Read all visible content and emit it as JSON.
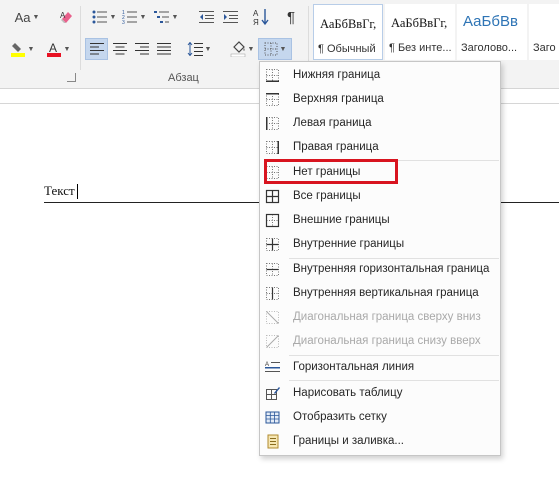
{
  "ribbon": {
    "font_size_label": "Aa",
    "paragraph_group_label": "Абзац",
    "sort_label": "А↓Я",
    "pilcrow": "¶",
    "styles": [
      {
        "sample": "АаБбВвГг,",
        "name": "¶ Обычный"
      },
      {
        "sample": "АаБбВвГг,",
        "name": "¶ Без инте..."
      },
      {
        "sample": "АаБбВв",
        "name": "Заголово..."
      },
      {
        "sample": "",
        "name": "Заго"
      }
    ],
    "colors": {
      "highlight": "#ffff00",
      "font": "#e81123"
    }
  },
  "document": {
    "text": "Текст"
  },
  "menu": {
    "items": [
      {
        "label": "Нижняя граница",
        "icon": "bottom-border-icon",
        "enabled": true
      },
      {
        "label": "Верхняя граница",
        "icon": "top-border-icon",
        "enabled": true
      },
      {
        "label": "Левая граница",
        "icon": "left-border-icon",
        "enabled": true
      },
      {
        "label": "Правая граница",
        "icon": "right-border-icon",
        "enabled": true
      },
      {
        "label": "Нет границы",
        "icon": "no-border-icon",
        "enabled": true
      },
      {
        "label": "Все границы",
        "icon": "all-borders-icon",
        "enabled": true
      },
      {
        "label": "Внешние границы",
        "icon": "outside-borders-icon",
        "enabled": true
      },
      {
        "label": "Внутренние границы",
        "icon": "inside-borders-icon",
        "enabled": true
      },
      {
        "label": "Внутренняя горизонтальная граница",
        "icon": "inside-horizontal-border-icon",
        "enabled": true
      },
      {
        "label": "Внутренняя вертикальная граница",
        "icon": "inside-vertical-border-icon",
        "enabled": true
      },
      {
        "label": "Диагональная граница сверху вниз",
        "icon": "diagonal-down-border-icon",
        "enabled": false
      },
      {
        "label": "Диагональная граница снизу вверх",
        "icon": "diagonal-up-border-icon",
        "enabled": false
      },
      {
        "label": "Горизонтальная линия",
        "icon": "horizontal-line-icon",
        "enabled": true
      },
      {
        "label": "Нарисовать таблицу",
        "icon": "draw-table-icon",
        "enabled": true
      },
      {
        "label": "Отобразить сетку",
        "icon": "view-gridlines-icon",
        "enabled": true
      },
      {
        "label": "Границы и заливка...",
        "icon": "borders-shading-icon",
        "enabled": true
      }
    ],
    "highlighted_item": "Нет границы",
    "highlight_color": "#d8141f"
  }
}
